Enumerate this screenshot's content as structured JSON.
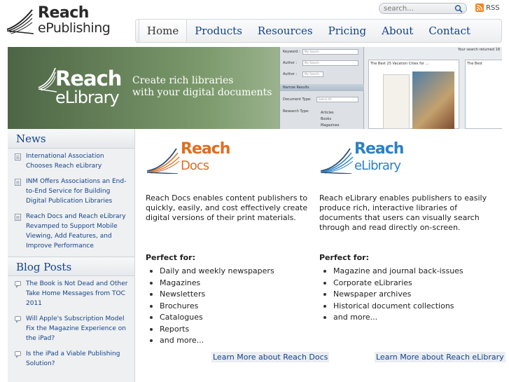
{
  "header": {
    "logo_line1": "Reach",
    "logo_line2": "ePublishing",
    "search_placeholder": "search...",
    "rss_label": "RSS"
  },
  "nav": {
    "items": [
      {
        "label": "Home",
        "active": true
      },
      {
        "label": "Products"
      },
      {
        "label": "Resources"
      },
      {
        "label": "Pricing"
      },
      {
        "label": "About"
      },
      {
        "label": "Contact"
      }
    ]
  },
  "banner": {
    "title1": "Reach",
    "title2": "eLibrary",
    "tagline1": "Create rich libraries",
    "tagline2": "with your digital documents",
    "screenshot": {
      "keyword_label": "Keyword :",
      "keyword_value": "My Search",
      "author_label": "Author :",
      "author_value": "My Search",
      "author2_label": "Author :",
      "author2_value": "My Search",
      "narrow_label": "Narrow Results",
      "doctype_label": "Document Type:",
      "doctype_value": "Select All",
      "research_label": "Research Type:",
      "opt1": "Articles",
      "opt2": "Books",
      "opt3": "Magazines",
      "results_text": "Your search returned 18",
      "tile1_title": "The Best 25 Vacation Cities for ...",
      "tile2_title": "The Best"
    }
  },
  "sidebar": {
    "news_title": "News",
    "news": [
      {
        "title": "International Association Chooses Reach eLibrary"
      },
      {
        "title": "INM Offers Associations an End-to-End Service for Building Digital Publication Libraries"
      },
      {
        "title": "Reach Docs and Reach eLibrary Revamped to Support Mobile Viewing, Add Features, and Improve Performance"
      }
    ],
    "blog_title": "Blog Posts",
    "blog": [
      {
        "title": "The Book is Not Dead and Other Take Home Messages from TOC 2011"
      },
      {
        "title": "Will Apple's Subscription Model Fix the Magazine Experience on the iPad?"
      },
      {
        "title": "Is the iPad a Viable Publishing Solution?"
      }
    ]
  },
  "products": {
    "docs": {
      "name1": "Reach",
      "name2": "Docs",
      "description": "Reach Docs enables content publishers to quickly, easily, and cost effectively create digital versions of their print materials.",
      "perfect_for": "Perfect for:",
      "items": [
        "Daily and weekly newspapers",
        "Magazines",
        "Newsletters",
        "Brochures",
        "Catalogues",
        "Reports",
        "and more..."
      ],
      "learn_more": "Learn More about Reach Docs"
    },
    "elibrary": {
      "name1": "Reach",
      "name2": "eLibrary",
      "description": "Reach eLibrary enables publishers to easily produce rich, interactive libraries of documents that users can visually search through and read directly on-screen.",
      "perfect_for": "Perfect for:",
      "items": [
        "Magazine and journal back-issues",
        "Corporate eLibraries",
        "Newspaper archives",
        "Historical document collections",
        "and more..."
      ],
      "learn_more": "Learn More about Reach eLibrary"
    }
  },
  "colors": {
    "link_blue": "#14428a",
    "docs_orange": "#e06d1f",
    "elibrary_blue": "#2a82c4"
  }
}
